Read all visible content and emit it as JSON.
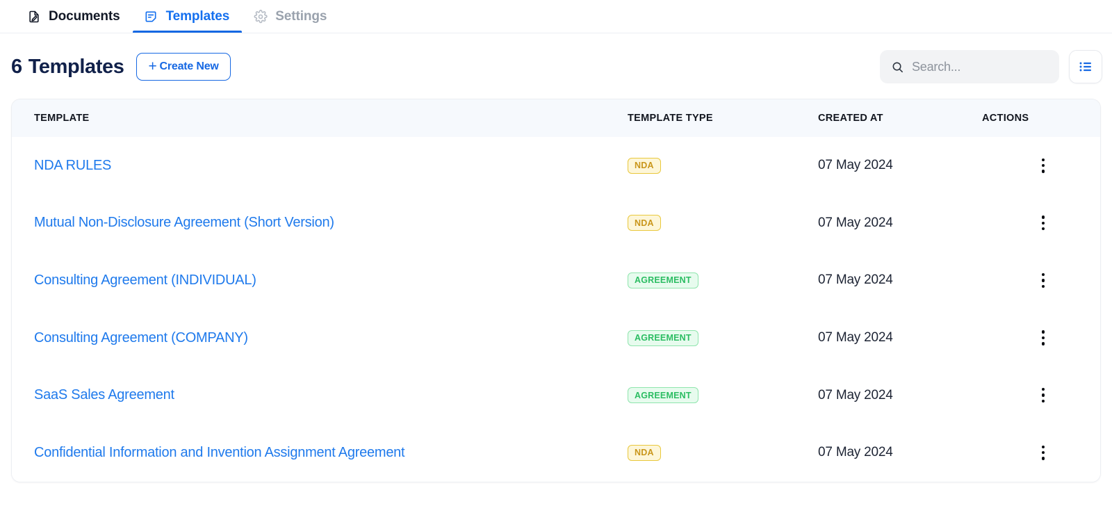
{
  "tabs": [
    {
      "label": "Documents",
      "icon": "document-edit-icon",
      "state": "inactive"
    },
    {
      "label": "Templates",
      "icon": "template-note-icon",
      "state": "active"
    },
    {
      "label": "Settings",
      "icon": "gear-icon",
      "state": "disabled"
    }
  ],
  "header": {
    "count": "6",
    "title": "Templates",
    "create_button": {
      "plus": "+",
      "label": "Create New"
    }
  },
  "search": {
    "placeholder": "Search...",
    "value": "",
    "icon": "search-icon"
  },
  "view_toggle": {
    "icon": "list-view-icon"
  },
  "table": {
    "columns": [
      "TEMPLATE",
      "TEMPLATE TYPE",
      "CREATED AT",
      "ACTIONS"
    ],
    "rows": [
      {
        "name": "NDA RULES",
        "type": "NDA",
        "type_style": "nda",
        "created_at": "07 May 2024",
        "actions_icon": "kebab-menu-icon"
      },
      {
        "name": "Mutual Non-Disclosure Agreement (Short Version)",
        "type": "NDA",
        "type_style": "nda",
        "created_at": "07 May 2024",
        "actions_icon": "kebab-menu-icon"
      },
      {
        "name": "Consulting Agreement (INDIVIDUAL)",
        "type": "AGREEMENT",
        "type_style": "agreement",
        "created_at": "07 May 2024",
        "actions_icon": "kebab-menu-icon"
      },
      {
        "name": "Consulting Agreement (COMPANY)",
        "type": "AGREEMENT",
        "type_style": "agreement",
        "created_at": "07 May 2024",
        "actions_icon": "kebab-menu-icon"
      },
      {
        "name": "SaaS Sales Agreement",
        "type": "AGREEMENT",
        "type_style": "agreement",
        "created_at": "07 May 2024",
        "actions_icon": "kebab-menu-icon"
      },
      {
        "name": "Confidential Information and Invention Assignment Agreement",
        "type": "NDA",
        "type_style": "nda",
        "created_at": "07 May 2024",
        "actions_icon": "kebab-menu-icon"
      }
    ]
  },
  "colors": {
    "accent_blue": "#1668e3",
    "link_blue": "#1f7aec",
    "title_navy": "#11214a",
    "nda_bg": "#fdf6d8",
    "nda_border": "#e9c83c",
    "nda_text": "#c9961b",
    "agreement_bg": "#e7fbee",
    "agreement_border": "#8fe5ad",
    "agreement_text": "#2bbd62",
    "table_header_bg": "#f6f9fd",
    "search_bg": "#f2f3f5"
  }
}
